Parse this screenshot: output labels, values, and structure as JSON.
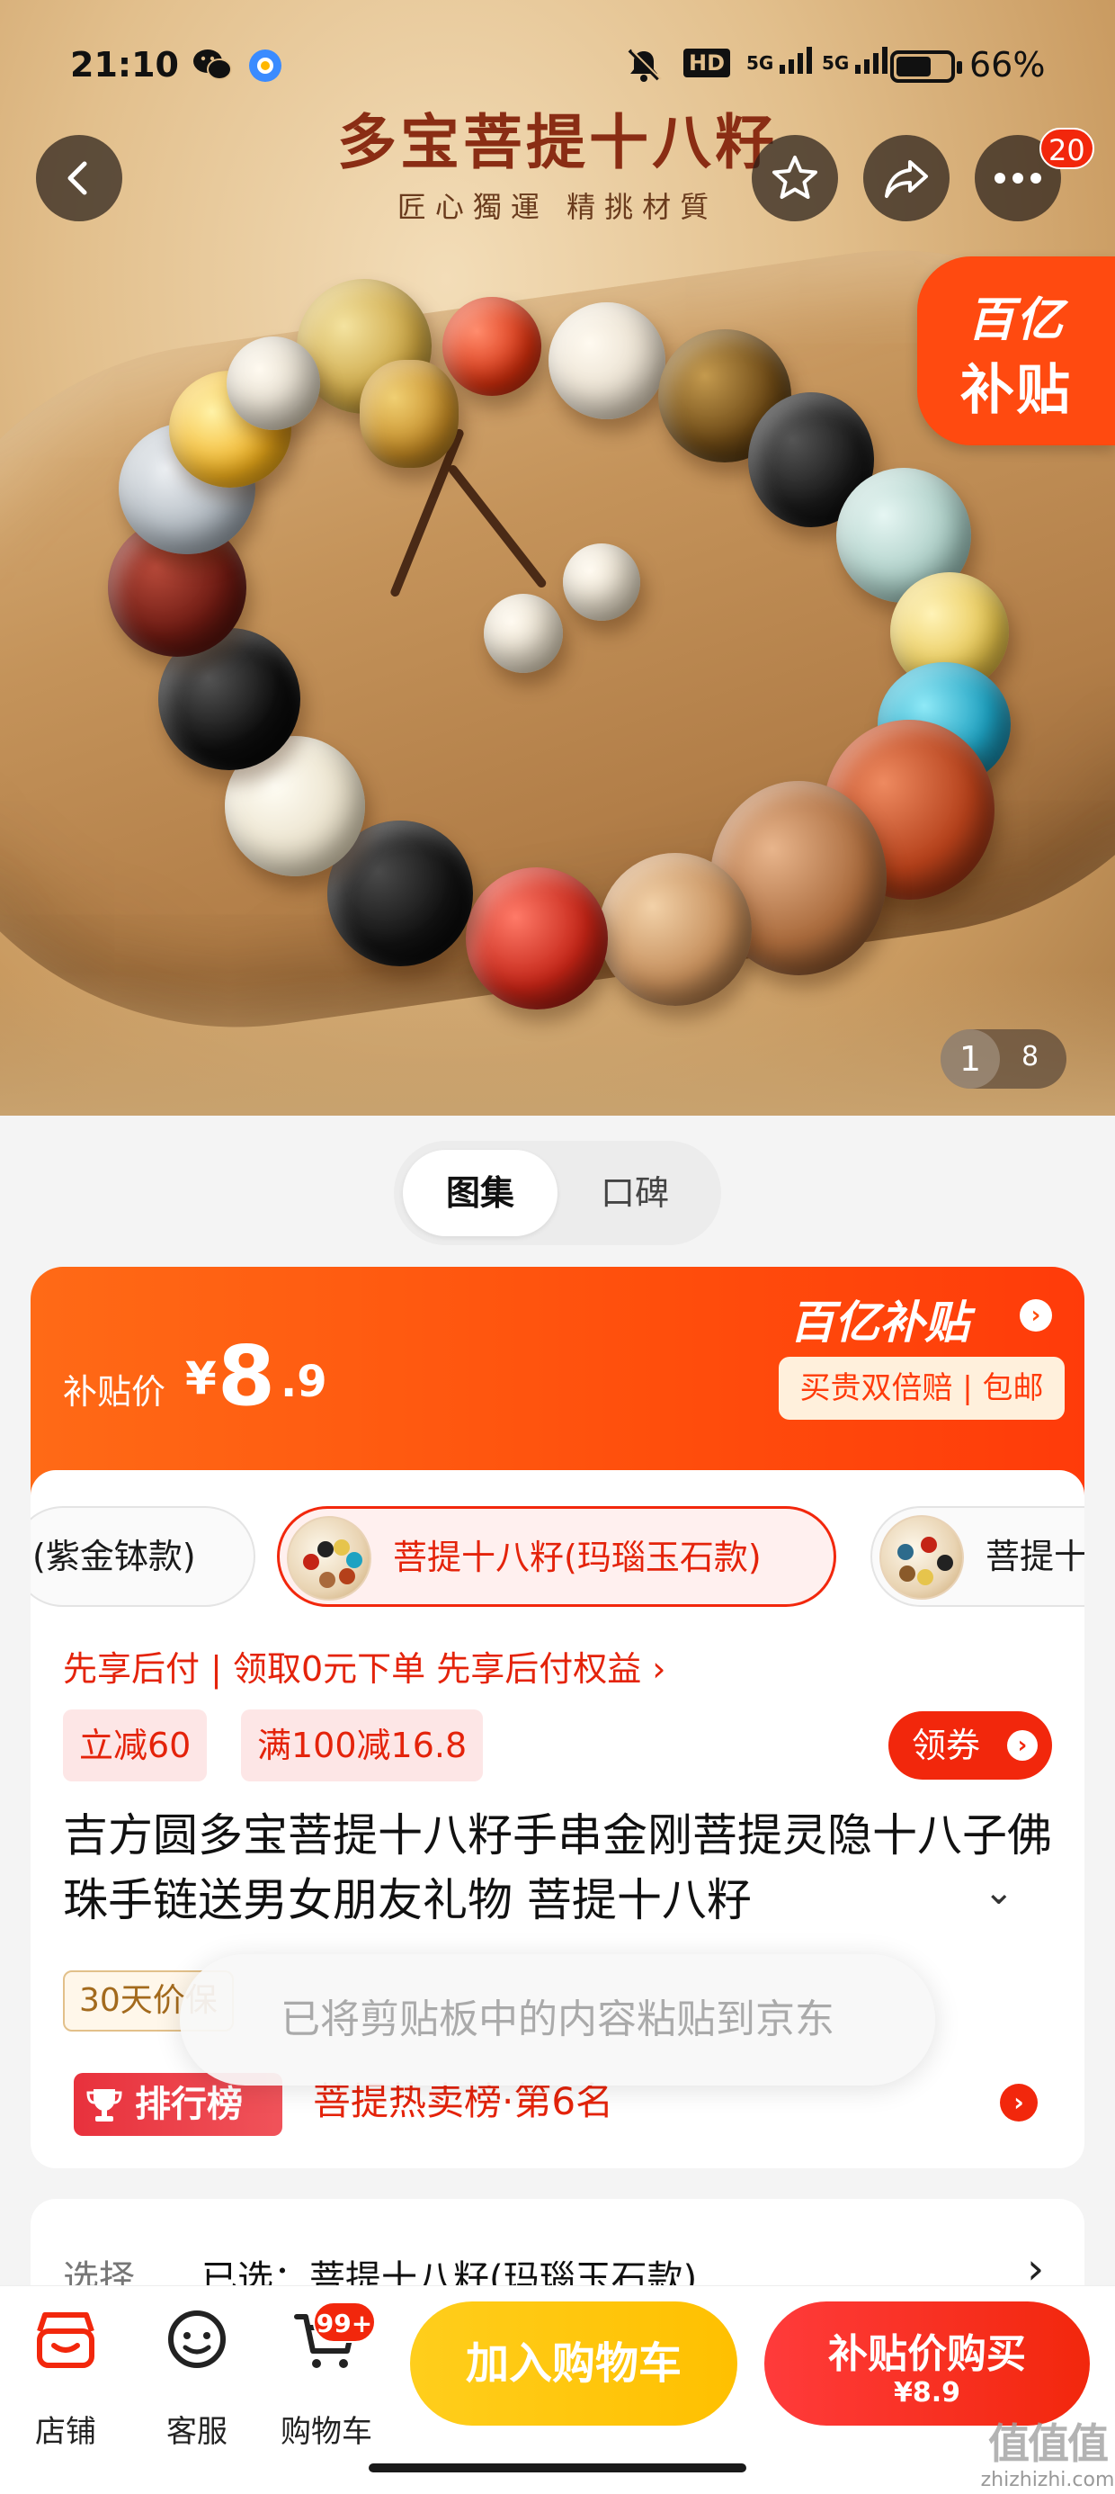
{
  "status_bar": {
    "time": "21:10",
    "hd": "HD",
    "sig1": "5G",
    "sig2": "5G",
    "battery_pct": "66%",
    "battery_level": 0.66
  },
  "hero": {
    "promo_title": "多宝菩提十八籽",
    "promo_subtitle": "匠心獨運 精挑材質",
    "more_badge": "20",
    "corner_badge": {
      "line1": "百亿",
      "line2": "补贴"
    },
    "image_index": "1",
    "image_total": "8"
  },
  "tabs": [
    {
      "label": "图集",
      "active": true
    },
    {
      "label": "口碑",
      "active": false
    }
  ],
  "price": {
    "label": "补贴价",
    "currency": "¥",
    "integer": "8",
    "decimal": ".9",
    "subsidy_logo": "百亿补贴",
    "subsidy_tag": "买贵双倍赔 | 包邮"
  },
  "variants": [
    {
      "label": "(紫金钵款)",
      "selected": false
    },
    {
      "label": "菩提十八籽(玛瑙玉石款)",
      "selected": true
    },
    {
      "label": "菩提十",
      "selected": false
    }
  ],
  "pay_later": "先享后付 | 领取0元下单 先享后付权益 ›",
  "coupons": [
    "立减60",
    "满100减16.8"
  ],
  "get_coupon": "领券",
  "product_title": "吉方圆多宝菩提十八籽手串金刚菩提灵隐十八子佛珠手链送男女朋友礼物 菩提十八籽",
  "protection": "30天价保",
  "ranking": {
    "badge": "排行榜",
    "text": "菩提热卖榜·第6名"
  },
  "toast": "已将剪贴板中的内容粘贴到京东",
  "selection": {
    "key": "选择",
    "value": "已选：菩提十八籽(玛瑙玉石款)"
  },
  "bottom_bar": {
    "store": "店铺",
    "service": "客服",
    "cart": "购物车",
    "cart_badge": "99+",
    "add_to_cart": "加入购物车",
    "buy_line1": "补贴价购买",
    "buy_line2": "¥8.9"
  },
  "watermark": {
    "big": "值值值",
    "small": "zhizhizhi.com"
  },
  "colors": {
    "accent": "#f2270c",
    "orange": "#ff4e0c",
    "yellow": "#ffc000"
  }
}
